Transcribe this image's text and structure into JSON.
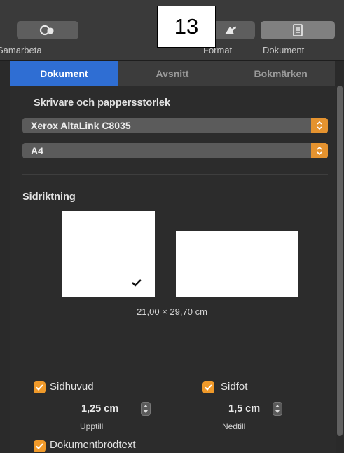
{
  "toolbar": {
    "collaborate_label": "Samarbeta",
    "format_label": "Format",
    "document_label": "Dokument",
    "callout_number": "13"
  },
  "tabs": [
    "Dokument",
    "Avsnitt",
    "Bokmärken"
  ],
  "printer_section": {
    "title": "Skrivare och pappersstorlek",
    "printer": "Xerox AltaLink C8035",
    "paper_size": "A4"
  },
  "orientation": {
    "title": "Sidriktning",
    "selected": "portrait",
    "dimensions": "21,00 × 29,70 cm"
  },
  "header": {
    "label": "Sidhuvud",
    "checked": true,
    "value": "1,25 cm",
    "sub_label": "Upptill"
  },
  "footer": {
    "label": "Sidfot",
    "checked": true,
    "value": "1,5 cm",
    "sub_label": "Nedtill"
  },
  "body_text": {
    "label": "Dokumentbrödtext",
    "checked": true
  },
  "colors": {
    "accent": "#2f6ed3",
    "checkbox": "#f09a2a",
    "background": "#2c2c2c"
  }
}
